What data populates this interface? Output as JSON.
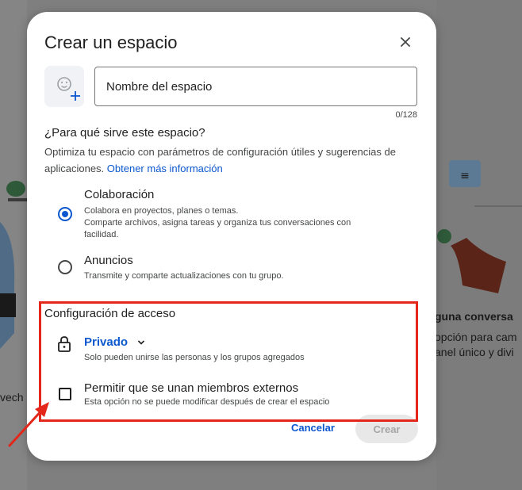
{
  "dialog": {
    "title": "Crear un espacio",
    "name_placeholder": "Nombre del espacio",
    "counter": "0/128",
    "purpose": {
      "heading": "¿Para qué sirve este espacio?",
      "description": "Optimiza tu espacio con parámetros de configuración útiles y sugerencias de aplicaciones.",
      "link": "Obtener más información"
    },
    "options": [
      {
        "title": "Colaboración",
        "lines": [
          "Colabora en proyectos, planes o temas.",
          "Comparte archivos, asigna tareas y organiza tus conversaciones con facilidad."
        ],
        "selected": true
      },
      {
        "title": "Anuncios",
        "lines": [
          "Transmite y comparte actualizaciones con tu grupo."
        ],
        "selected": false
      }
    ],
    "access": {
      "heading": "Configuración de acceso",
      "privacy_label": "Privado",
      "privacy_desc": "Solo pueden unirse las personas y los grupos agregados",
      "external_label": "Permitir que se unan miembros externos",
      "external_desc": "Esta opción no se puede modificar después de crear el espacio",
      "external_checked": false
    },
    "buttons": {
      "cancel": "Cancelar",
      "create": "Crear"
    }
  },
  "background": {
    "right_heading": "guna conversa",
    "right_line1": "opción para cam",
    "right_line2": "anel único y divi",
    "left_partial": "vech"
  },
  "colors": {
    "accent": "#0b57d0",
    "highlight": "#e3271a"
  }
}
